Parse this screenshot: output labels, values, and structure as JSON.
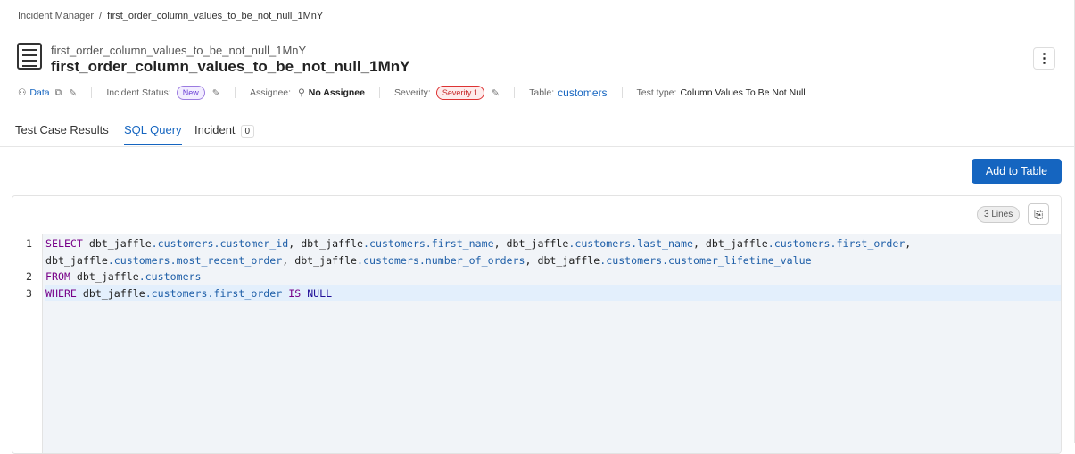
{
  "breadcrumb": {
    "root": "Incident Manager",
    "separator": "/",
    "current": "first_order_column_values_to_be_not_null_1MnY"
  },
  "header": {
    "subtitle": "first_order_column_values_to_be_not_null_1MnY",
    "title": "first_order_column_values_to_be_not_null_1MnY",
    "more_icon": "⋮"
  },
  "meta": {
    "owner": "Data",
    "status_label": "Incident Status:",
    "status": "New",
    "assignee_label": "Assignee:",
    "assignee": "No Assignee",
    "severity_label": "Severity:",
    "severity": "Severity 1",
    "table_label": "Table:",
    "table": "customers",
    "test_type_label": "Test type:",
    "test_type": "Column Values To Be Not Null"
  },
  "tabs": [
    {
      "label": "Test Case Results"
    },
    {
      "label": "SQL Query",
      "active": true
    },
    {
      "label": "Incident",
      "badge": "0"
    }
  ],
  "add_button": "Add to Table",
  "editor": {
    "lines_badge": "3 Lines",
    "rows": [
      {
        "ln": "1",
        "tokens": [
          [
            "SELECT",
            "kw"
          ],
          [
            " dbt_jaffle",
            "pl"
          ],
          [
            ".customers.customer_id",
            "pr"
          ],
          [
            ", dbt_jaffle",
            "pl"
          ],
          [
            ".customers.first_name",
            "pr"
          ],
          [
            ", dbt_jaffle",
            "pl"
          ],
          [
            ".customers.last_name",
            "pr"
          ],
          [
            ", dbt_jaffle",
            "pl"
          ],
          [
            ".customers.first_order",
            "pr"
          ],
          [
            ",",
            "pl"
          ]
        ]
      },
      {
        "ln": "",
        "tokens": [
          [
            "dbt_jaffle",
            "pl"
          ],
          [
            ".customers.most_recent_order",
            "pr"
          ],
          [
            ", dbt_jaffle",
            "pl"
          ],
          [
            ".customers.number_of_orders",
            "pr"
          ],
          [
            ", dbt_jaffle",
            "pl"
          ],
          [
            ".customers.customer_lifetime_value",
            "pr"
          ]
        ]
      },
      {
        "ln": "2",
        "tokens": [
          [
            "FROM",
            "kw"
          ],
          [
            " dbt_jaffle",
            "pl"
          ],
          [
            ".customers",
            "pr"
          ]
        ]
      },
      {
        "ln": "3",
        "hl": true,
        "tokens": [
          [
            "WHERE",
            "kw"
          ],
          [
            " dbt_jaffle",
            "pl"
          ],
          [
            ".customers.first_order",
            "pr"
          ],
          [
            " ",
            "pl"
          ],
          [
            "IS",
            "kw"
          ],
          [
            " ",
            "pl"
          ],
          [
            "NULL",
            "at"
          ]
        ]
      }
    ]
  }
}
